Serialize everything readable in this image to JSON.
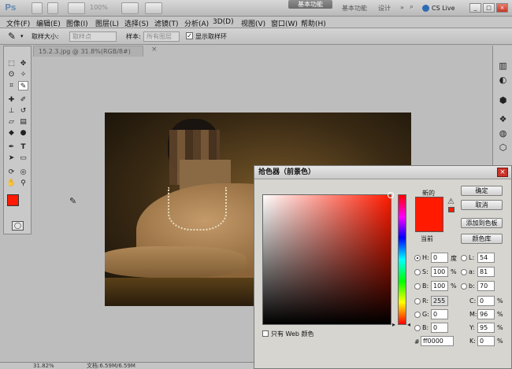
{
  "titlebar": {
    "logo": "Ps",
    "zoom": "100%",
    "workspace_active": "基本功能",
    "workspace_essentials": "基本功能",
    "workspace_design": "设计",
    "cs_live": "CS Live"
  },
  "menus": [
    "文件(F)",
    "编辑(E)",
    "图像(I)",
    "图层(L)",
    "选择(S)",
    "滤镜(T)",
    "分析(A)",
    "3D(D)",
    "视图(V)",
    "窗口(W)",
    "帮助(H)"
  ],
  "options": {
    "sample_size_label": "取样大小:",
    "sample_size_value": "取样点",
    "sample_label": "样本:",
    "sample_value": "所有图层",
    "show_ring_label": "显示取样环"
  },
  "document": {
    "tab_title": "15.2.3.jpg @ 31.8%(RGB/8#)",
    "close": "×"
  },
  "status": {
    "zoom": "31.82%",
    "doc_size": "文档:6.59M/6.59M"
  },
  "color_picker": {
    "title": "拾色器（前景色）",
    "new_label": "新的",
    "current_label": "当前",
    "new_color": "#ff1a00",
    "current_color": "#ff1a00",
    "buttons": {
      "ok": "确定",
      "cancel": "取消",
      "add_swatch": "添加到色板",
      "libraries": "颜色库"
    },
    "hsb": {
      "h": "0",
      "h_unit": "度",
      "s": "100",
      "s_unit": "%",
      "b": "100",
      "b_unit": "%"
    },
    "rgb": {
      "r": "255",
      "g": "0",
      "b": "0"
    },
    "lab": {
      "l": "54",
      "a": "81",
      "b": "70"
    },
    "cmyk": {
      "c": "0",
      "m": "96",
      "y": "95",
      "k": "0",
      "unit": "%"
    },
    "hex_label": "#",
    "hex": "ff0000",
    "web_only_label": "只有 Web 颜色",
    "labels": {
      "H": "H:",
      "S": "S:",
      "B": "B:",
      "R": "R:",
      "G": "G:",
      "Bb": "B:",
      "L": "L:",
      "a": "a:",
      "b": "b:",
      "C": "C:",
      "M": "M:",
      "Y": "Y:",
      "K": "K:"
    }
  },
  "foreground_color": "#ff1a00"
}
